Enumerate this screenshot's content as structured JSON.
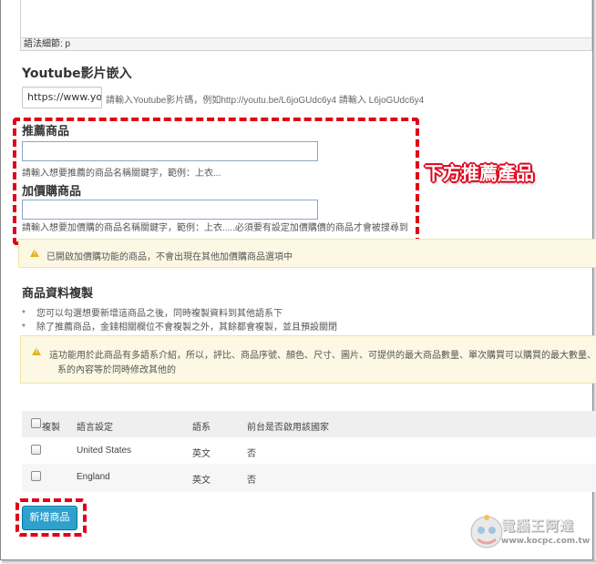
{
  "editor": {
    "path_label": "語法細節: p"
  },
  "youtube": {
    "heading": "Youtube影片嵌入",
    "input_value": "https://www.youtu",
    "hint": "請輸入Youtube影片碼，例如http://youtu.be/L6joGUdc6y4 請輸入 L6joGUdc6y4"
  },
  "recommend": {
    "heading": "推薦商品",
    "input_value": "",
    "hint": "請輸入想要推薦的商品名稱關鍵字，範例：上衣..."
  },
  "addon": {
    "heading": "加價購商品",
    "input_value": "",
    "hint": "請輸入想要加價購的商品名稱關鍵字，範例：上衣.....必須要有設定加價購價的商品才會被搜尋到"
  },
  "annotation": {
    "text": "下方推薦產品"
  },
  "alert_addon": {
    "text": "已開啟加價購功能的商品，不會出現在其他加價購商品選項中"
  },
  "copy_section": {
    "heading": "商品資料複製",
    "bullets": [
      "您可以勾選想要新增這商品之後，同時複製資料到其他語系下",
      "除了推薦商品，金錢相關欄位不會複製之外，其餘都會複製，並且預設關閉"
    ],
    "alert_line1": "這功能用於此商品有多語系介紹，所以，評比、商品序號、顏色、尺寸、圖片、可提供的最大商品數量、單次購買可以購買的最大數量、",
    "alert_line2": "系的內容等於同時修改其他的"
  },
  "table": {
    "headers": {
      "copy": "複製",
      "lang": "語言設定",
      "sys": "語系",
      "front": "前台是否啟用該國家"
    },
    "rows": [
      {
        "lang": "United States",
        "sys": "英文",
        "front": "否"
      },
      {
        "lang": "England",
        "sys": "英文",
        "front": "否"
      }
    ]
  },
  "actions": {
    "add_product": "新增商品"
  },
  "watermark": {
    "text": "電腦王阿達",
    "url": "www.kocpc.com.tw"
  },
  "colors": {
    "annotation_red": "#e0001a",
    "button_blue": "#2ea2cc",
    "alert_bg": "#fcf8e3"
  }
}
